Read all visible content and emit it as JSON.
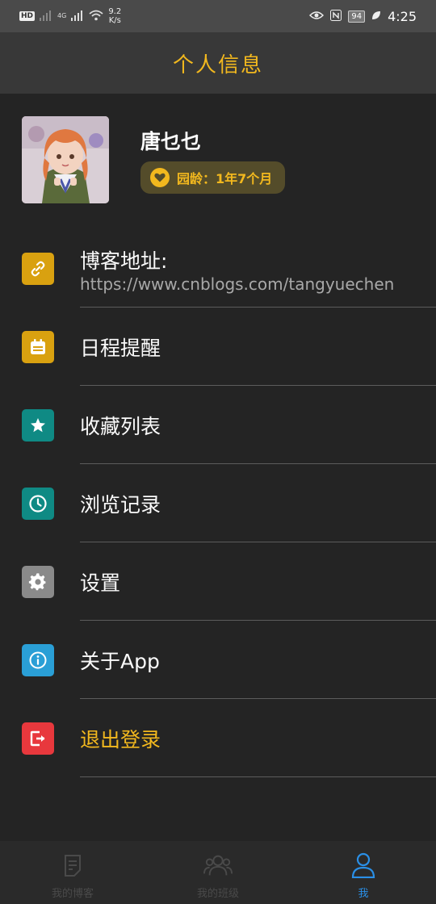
{
  "status_bar": {
    "hd_label": "HD",
    "network_label": "4G",
    "speed_value": "9.2",
    "speed_unit": "K/s",
    "battery": "94",
    "time": "4:25"
  },
  "header": {
    "title": "个人信息"
  },
  "profile": {
    "username": "唐乜乜",
    "age_label": "园龄：1年7个月"
  },
  "menu": {
    "blog": {
      "title": "博客地址:",
      "url": "https://www.cnblogs.com/tangyuechen",
      "icon": "link-icon",
      "color": "#d9a110"
    },
    "items": [
      {
        "label": "日程提醒",
        "icon": "calendar-icon",
        "color": "#d9a110"
      },
      {
        "label": "收藏列表",
        "icon": "star-icon",
        "color": "#0f8a84"
      },
      {
        "label": "浏览记录",
        "icon": "clock-icon",
        "color": "#0f8a84"
      },
      {
        "label": "设置",
        "icon": "gear-icon",
        "color": "#8a8a8a"
      },
      {
        "label": "关于App",
        "icon": "info-icon",
        "color": "#2a9fd6"
      },
      {
        "label": "退出登录",
        "icon": "logout-icon",
        "color": "#e8383d",
        "highlight": "#f2b81e"
      }
    ]
  },
  "bottom_nav": {
    "tabs": [
      {
        "label": "我的博客",
        "icon": "document-icon",
        "active": false
      },
      {
        "label": "我的班级",
        "icon": "group-icon",
        "active": false
      },
      {
        "label": "我",
        "icon": "person-icon",
        "active": true
      }
    ],
    "active_color": "#2a8fe6"
  },
  "colors": {
    "accent": "#f2b81e",
    "background": "#242424",
    "header_bg": "#383838"
  }
}
